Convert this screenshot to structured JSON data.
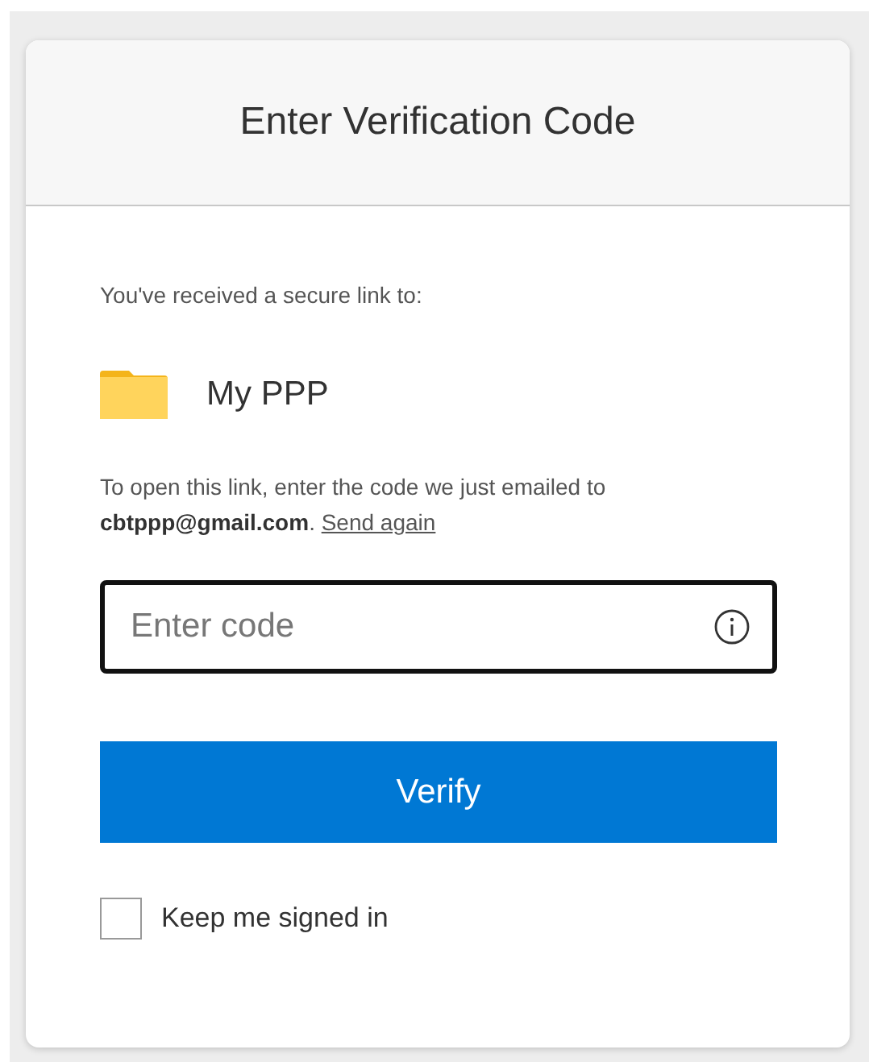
{
  "dialog": {
    "title": "Enter Verification Code"
  },
  "intro": "You've received a secure link to:",
  "item": {
    "name": "My PPP"
  },
  "instructions": "To open this link, enter the code we just emailed to **cbtppp@gmail.com**.",
  "resend_link": "Send again",
  "code_field": {
    "placeholder": "Enter code",
    "focused": true
  },
  "verify_button": "Verify",
  "keep_signed_in": {
    "label": "Keep me signed in",
    "checked": false
  }
}
